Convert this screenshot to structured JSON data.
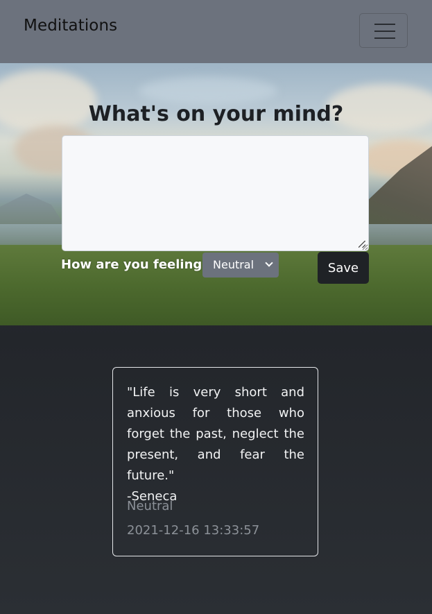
{
  "navbar": {
    "brand": "Meditations",
    "toggler_icon": "hamburger-menu-icon"
  },
  "hero": {
    "heading": "What's on your mind?",
    "entry_value": "",
    "feeling_label": "How are you feeling?",
    "feeling_selected": "Neutral",
    "save_label": "Save"
  },
  "entries": [
    {
      "quote": "\"Life is very short and anxious for those who forget the past, neglect the present, and fear the future.\"",
      "author": "-Seneca",
      "mood": "Neutral",
      "timestamp": "2021-12-16 13:33:57"
    }
  ],
  "colors": {
    "navbar_bg": "#6c727d",
    "button_dark": "#1f2226",
    "page_bg": "#2b2f34"
  }
}
